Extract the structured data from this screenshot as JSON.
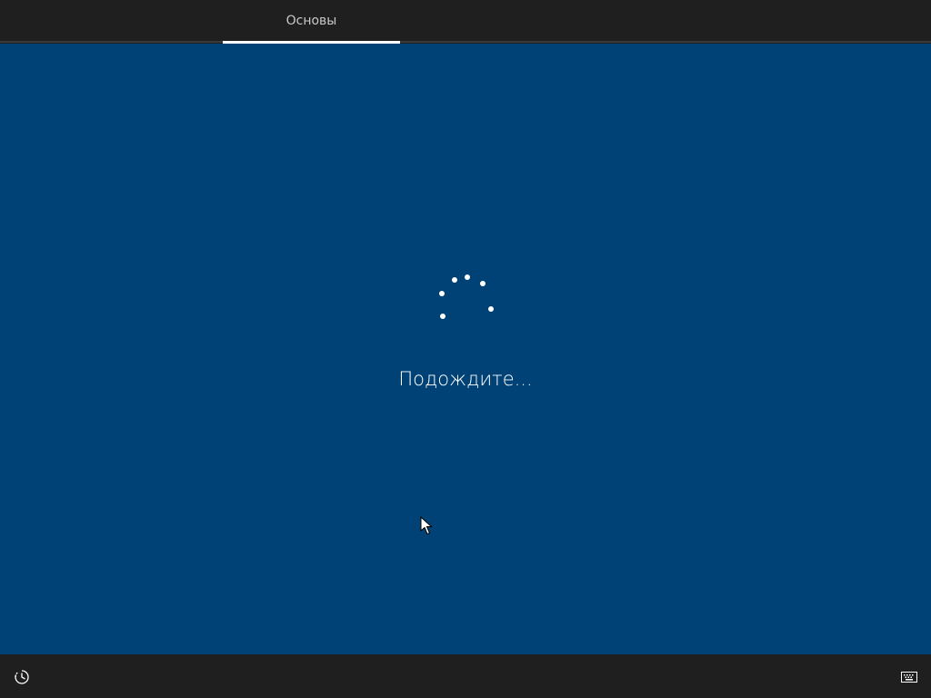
{
  "header": {
    "tabs": [
      {
        "label": "Основы",
        "active": true
      }
    ]
  },
  "main": {
    "status_text": "Подождите...",
    "spinner": "loading-spinner-icon"
  },
  "footer": {
    "left_icon": "ease-of-access-icon",
    "right_icon": "keyboard-icon"
  },
  "colors": {
    "background": "#004275",
    "chrome": "#1f1f1f",
    "accent": "#ffffff"
  }
}
